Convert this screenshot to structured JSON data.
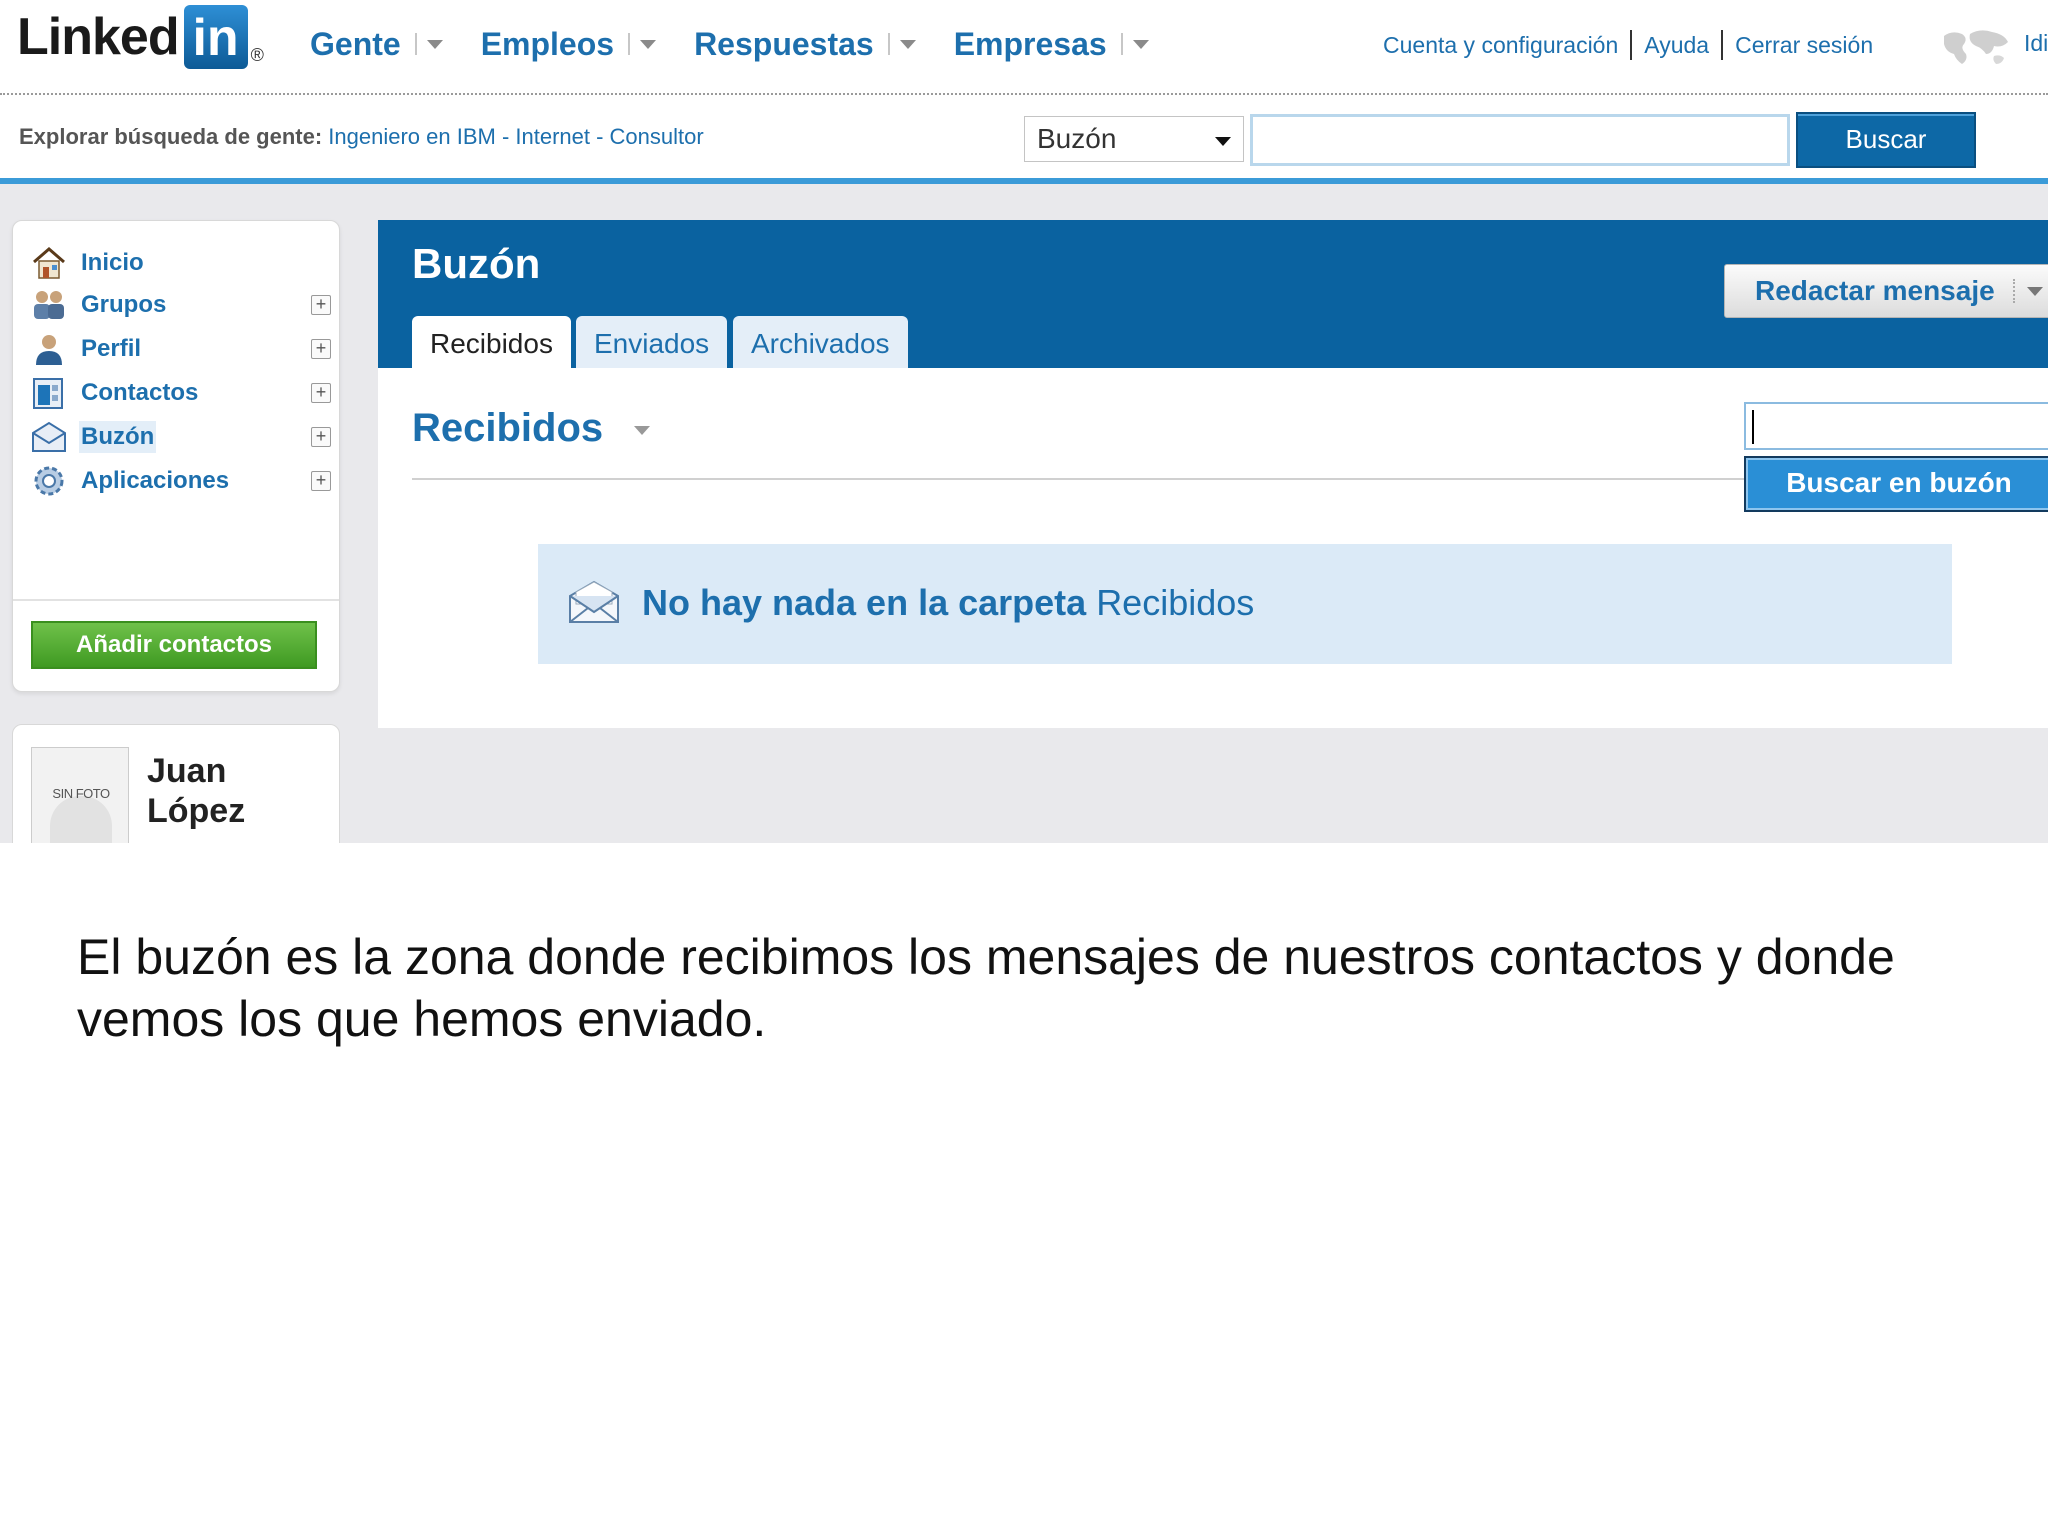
{
  "brand": {
    "logo_text": "Linked",
    "logo_box": "in",
    "registered": "®",
    "accent": "#1d6fad",
    "header_blue": "#0a62a0"
  },
  "mainnav": {
    "items": [
      {
        "label": "Gente"
      },
      {
        "label": "Empleos"
      },
      {
        "label": "Respuestas"
      },
      {
        "label": "Empresas"
      }
    ]
  },
  "toplinks": {
    "account": "Cuenta y configuración",
    "help": "Ayuda",
    "logout": "Cerrar sesión",
    "language": "Idi"
  },
  "search": {
    "explore_prefix": "Explorar búsqueda de gente:",
    "explore_links": "Ingeniero en IBM - Internet - Consultor",
    "scope_value": "Buzón",
    "query": "",
    "button": "Buscar"
  },
  "sidebar": {
    "items": [
      {
        "label": "Inicio",
        "icon": "home-icon"
      },
      {
        "label": "Grupos",
        "icon": "groups-icon"
      },
      {
        "label": "Perfil",
        "icon": "profile-icon"
      },
      {
        "label": "Contactos",
        "icon": "contacts-icon"
      },
      {
        "label": "Buzón",
        "icon": "inbox-icon"
      },
      {
        "label": "Aplicaciones",
        "icon": "applications-icon"
      }
    ],
    "add_contacts": "Añadir contactos"
  },
  "profile": {
    "no_photo": "SIN FOTO",
    "first_name": "Juan",
    "last_name": "López"
  },
  "inbox": {
    "title": "Buzón",
    "tabs": [
      "Recibidos",
      "Enviados",
      "Archivados"
    ],
    "compose": "Redactar mensaje",
    "section_title": "Recibidos",
    "search_value": "",
    "search_button": "Buscar en buzón",
    "empty_bold": "No hay nada en la carpeta",
    "empty_folder": "Recibidos"
  },
  "caption": "El buzón es la zona donde recibimos los mensajes de nuestros contactos y donde vemos los que hemos enviado."
}
